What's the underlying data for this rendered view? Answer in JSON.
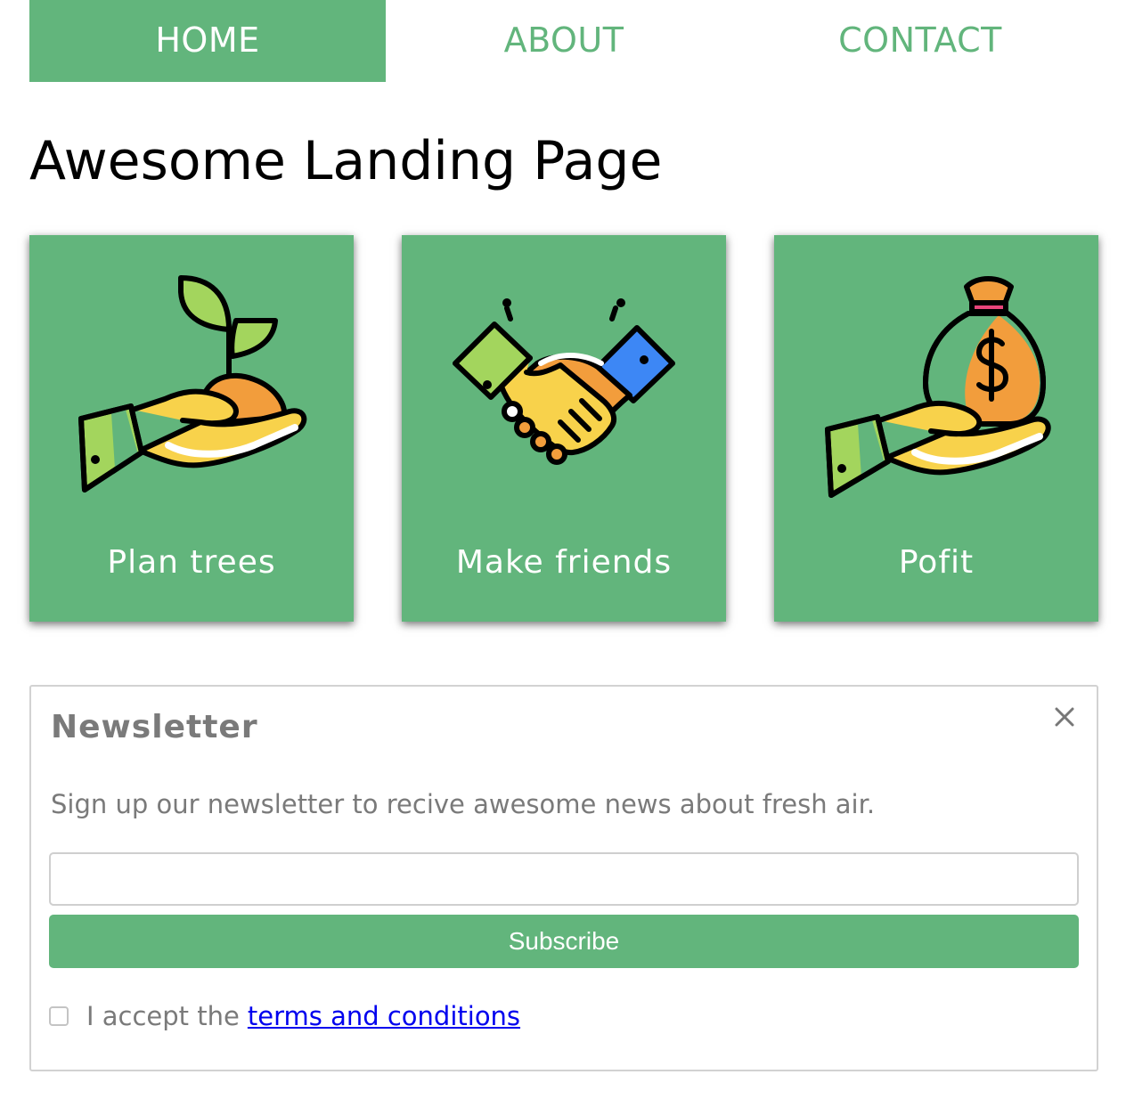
{
  "nav": {
    "items": [
      {
        "label": "HOME",
        "active": true
      },
      {
        "label": "ABOUT",
        "active": false
      },
      {
        "label": "CONTACT",
        "active": false
      }
    ]
  },
  "page": {
    "title": "Awesome Landing Page"
  },
  "cards": [
    {
      "label": "Plan trees",
      "icon": "hand-with-sprout-icon"
    },
    {
      "label": "Make friends",
      "icon": "handshake-icon"
    },
    {
      "label": "Pofit",
      "icon": "hand-with-money-bag-icon"
    }
  ],
  "newsletter": {
    "title": "Newsletter",
    "close_symbol": "×",
    "description": "Sign up our newsletter to recive awesome news about fresh air.",
    "email_value": "",
    "email_placeholder": "",
    "subscribe_label": "Subscribe",
    "terms_prefix": "I accept the",
    "terms_link": "terms and conditions",
    "terms_checked": false
  },
  "colors": {
    "accent": "#62b57c",
    "text_muted": "#7a7a7a",
    "link": "#0000ee",
    "icon_outline": "#000000",
    "icon_yellow": "#f8d24b",
    "icon_orange": "#f29d3c",
    "icon_lightgreen": "#a3d55d",
    "icon_blue": "#3d87f5",
    "icon_pink": "#e8457a"
  }
}
